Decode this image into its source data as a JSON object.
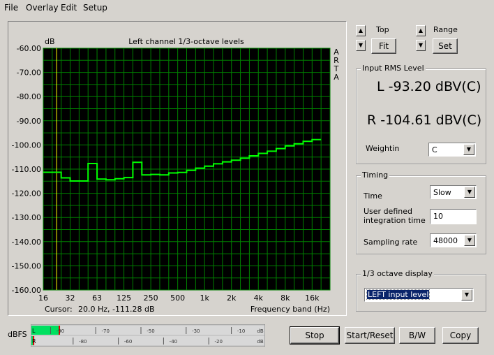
{
  "menu": [
    "File",
    "Overlay",
    "Edit",
    "Setup"
  ],
  "chart": {
    "dB_label": "dB",
    "title": "Left channel 1/3-octave levels",
    "arta": [
      "A",
      "R",
      "T",
      "A"
    ],
    "cursor_label": "Cursor:",
    "cursor_value": "20.0 Hz, -111.28 dB",
    "xlabel": "Frequency band (Hz)"
  },
  "chart_data": {
    "type": "line",
    "title": "Left channel 1/3-octave levels",
    "xlabel": "Frequency band (Hz)",
    "ylabel": "dB",
    "ylim": [
      -160,
      -60
    ],
    "yticks": [
      "-60.00",
      "-70.00",
      "-80.00",
      "-90.00",
      "-100.00",
      "-110.00",
      "-120.00",
      "-130.00",
      "-140.00",
      "-150.00",
      "-160.00"
    ],
    "xtick_labels": [
      "16",
      "32",
      "63",
      "125",
      "250",
      "500",
      "1k",
      "2k",
      "4k",
      "8k",
      "16k"
    ],
    "cursor_band_hz": "20",
    "grid": true,
    "bands": [
      "16",
      "20",
      "25",
      "31.5",
      "40",
      "50",
      "63",
      "80",
      "100",
      "125",
      "160",
      "200",
      "250",
      "315",
      "400",
      "500",
      "630",
      "800",
      "1k",
      "1.25k",
      "1.6k",
      "2k",
      "2.5k",
      "3.15k",
      "4k",
      "5k",
      "6.3k",
      "8k",
      "10k",
      "12.5k",
      "16k",
      "20k"
    ],
    "series": [
      {
        "color": "#00ff00",
        "values": [
          -111.3,
          -111.3,
          -113.6,
          -114.9,
          -114.9,
          -107.7,
          -114.1,
          -114.4,
          -114.0,
          -113.5,
          -107.2,
          -112.4,
          -112.2,
          -112.4,
          -111.6,
          -111.4,
          -110.5,
          -109.6,
          -108.8,
          -107.8,
          -107.0,
          -106.3,
          -105.5,
          -104.5,
          -103.5,
          -102.6,
          -101.5,
          -100.4,
          -99.5,
          -98.5,
          -97.8
        ]
      }
    ]
  },
  "top": {
    "label": "Top",
    "fit_button": "Fit"
  },
  "range": {
    "label": "Range",
    "set_button": "Set"
  },
  "rms": {
    "title": "Input RMS Level",
    "left": "L -93.20 dBV(C)",
    "right": "R -104.61 dBV(C)",
    "weighting_label": "Weightin",
    "weighting_value": "C"
  },
  "timing": {
    "title": "Timing",
    "time_label": "Time",
    "time_value": "Slow",
    "user_label_1": "User defined",
    "user_label_2": "integration time",
    "integration_value": "10",
    "sampling_label": "Sampling rate",
    "sampling_value": "48000"
  },
  "octave": {
    "title": "1/3 octave display",
    "value": "LEFT input level"
  },
  "meter": {
    "label": "dBFS",
    "L": "L",
    "R": "R",
    "top_ticks": [
      "-90",
      "-70",
      "-50",
      "-30",
      "-10",
      "dB"
    ],
    "bottom_ticks": [
      "-80",
      "-60",
      "-40",
      "-20",
      "dB"
    ],
    "left_level": -93.2,
    "right_level": -104.6
  },
  "buttons": {
    "stop": "Stop",
    "start_reset": "Start/Reset",
    "bw": "B/W",
    "copy": "Copy"
  },
  "colors": {
    "plot_bg": "#000000",
    "grid": "#008000",
    "trace": "#00ff00",
    "cursor": "#ffff00",
    "meter_fill": "#00e060",
    "meter_peak": "#e00000",
    "selection": "#0a246a"
  }
}
